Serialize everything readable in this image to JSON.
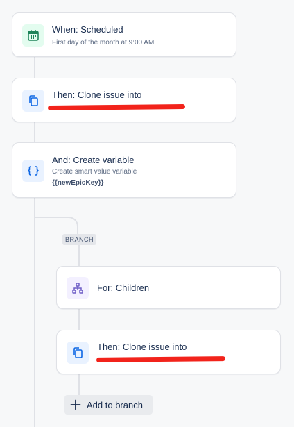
{
  "trigger": {
    "title": "When: Scheduled",
    "subtitle": "First day of the month at 9:00 AM",
    "icon": "calendar-icon"
  },
  "clone_action": {
    "title": "Then: Clone issue into",
    "icon": "copy-icon"
  },
  "variable_action": {
    "title": "And: Create variable",
    "subtitle": "Create smart value variable",
    "variable": "{{newEpicKey}}",
    "icon": "braces-icon"
  },
  "branch": {
    "badge": "BRANCH",
    "for_title": "For: Children",
    "for_icon": "hierarchy-icon",
    "child_clone_title": "Then: Clone issue into",
    "child_clone_icon": "copy-icon",
    "add_label": "Add to branch",
    "add_icon": "plus-icon"
  },
  "colors": {
    "background": "#f7f8f9",
    "card_border": "#dfe1e6",
    "connector": "#dfe1e6",
    "trigger_icon": "#1f845a",
    "action_icon": "#0c66e4",
    "branch_icon": "#6e5dc6",
    "redaction": "#f2231b"
  }
}
